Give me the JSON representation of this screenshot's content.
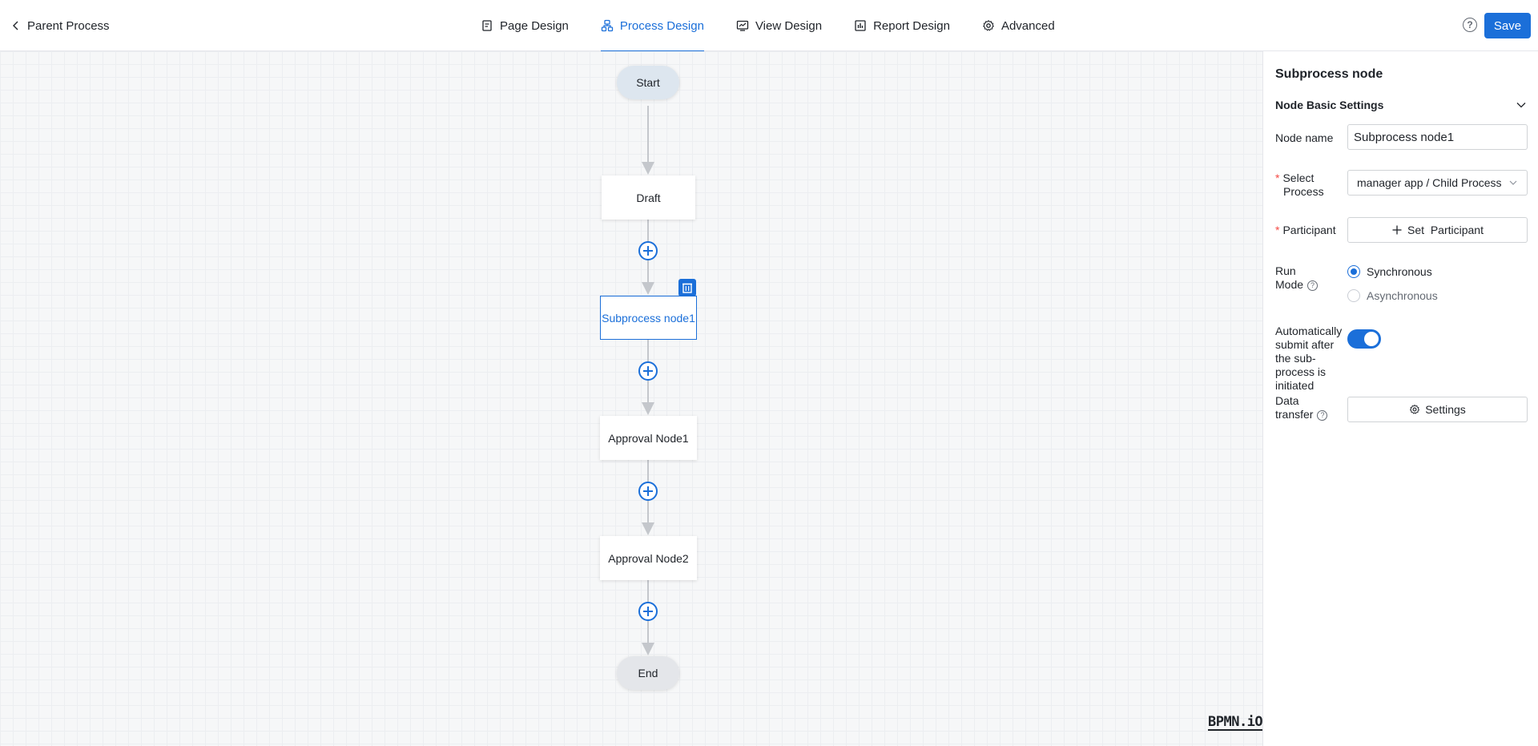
{
  "header": {
    "back_label": "Parent Process",
    "tabs": [
      {
        "label": "Page Design",
        "icon": "page-icon",
        "active": false
      },
      {
        "label": "Process Design",
        "icon": "process-icon",
        "active": true
      },
      {
        "label": "View Design",
        "icon": "view-icon",
        "active": false
      },
      {
        "label": "Report Design",
        "icon": "report-icon",
        "active": false
      },
      {
        "label": "Advanced",
        "icon": "gear-icon",
        "active": false
      }
    ],
    "help_label": "?",
    "save_label": "Save"
  },
  "flow": {
    "nodes": [
      {
        "id": "start",
        "label": "Start"
      },
      {
        "id": "draft",
        "label": "Draft"
      },
      {
        "id": "subprocess",
        "label": "Subprocess node1",
        "selected": true
      },
      {
        "id": "approval1",
        "label": "Approval Node1"
      },
      {
        "id": "approval2",
        "label": "Approval Node2"
      },
      {
        "id": "end",
        "label": "End"
      }
    ],
    "watermark": "BPMN.iO"
  },
  "panel": {
    "title": "Subprocess node",
    "section_title": "Node Basic Settings",
    "node_name_label": "Node name",
    "node_name_value": "Subprocess node1",
    "select_process_label_1": "Select",
    "select_process_label_2": "Process",
    "select_process_value": "manager app / Child Process",
    "participant_label": "Participant",
    "participant_button": "Set  Participant",
    "run_mode_label_1": "Run",
    "run_mode_label_2": "Mode",
    "run_mode_options": [
      "Synchronous",
      "Asynchronous"
    ],
    "run_mode_selected": "Synchronous",
    "auto_submit_label": [
      "Automatically",
      "submit after",
      "the sub-",
      "process is",
      "initiated"
    ],
    "auto_submit_on": true,
    "data_transfer_label_1": "Data",
    "data_transfer_label_2": "transfer",
    "settings_button": "Settings",
    "required_mark": "*",
    "accent_color": "#1b6fd9"
  }
}
